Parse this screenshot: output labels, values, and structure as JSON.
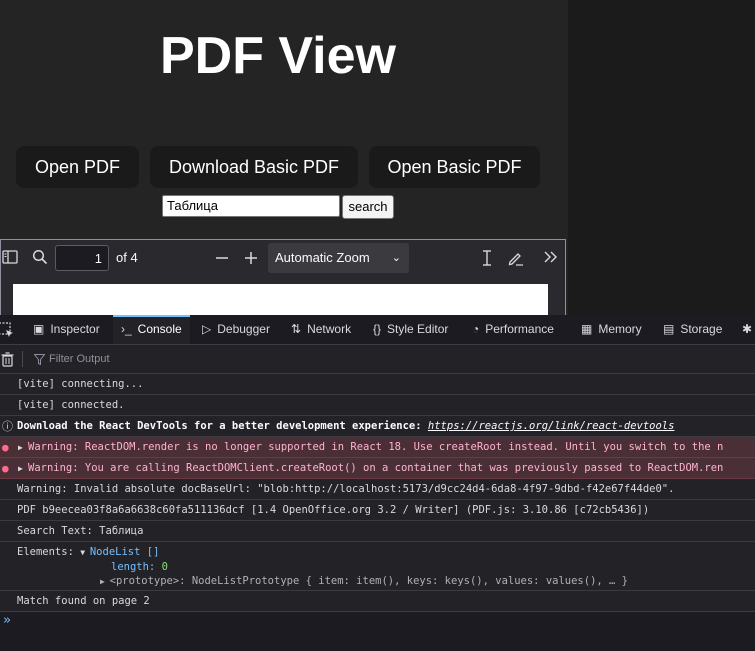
{
  "app": {
    "title": "PDF View",
    "buttons": {
      "open_pdf": "Open PDF",
      "download_basic_pdf": "Download Basic PDF",
      "open_basic_pdf": "Open Basic PDF"
    },
    "search": {
      "value": "Таблица",
      "button_label": "search"
    }
  },
  "pdf_viewer": {
    "page_number": "1",
    "page_count_label": "of 4",
    "zoom": "Automatic Zoom"
  },
  "devtools": {
    "tabs": [
      {
        "label": "Inspector",
        "icon": "inspector-icon"
      },
      {
        "label": "Console",
        "icon": "console-icon",
        "active": true
      },
      {
        "label": "Debugger",
        "icon": "debugger-icon"
      },
      {
        "label": "Network",
        "icon": "network-icon"
      },
      {
        "label": "Style Editor",
        "icon": "style-editor-icon"
      },
      {
        "label": "Performance",
        "icon": "performance-icon"
      },
      {
        "label": "Memory",
        "icon": "memory-icon"
      },
      {
        "label": "Storage",
        "icon": "storage-icon"
      }
    ],
    "filter_placeholder": "Filter Output",
    "console": {
      "m1": "[vite] connecting...",
      "m2": "[vite] connected.",
      "m3_prefix": "Download the React DevTools for a better development experience: ",
      "m3_link": "https://reactjs.org/link/react-devtools",
      "m4": "Warning: ReactDOM.render is no longer supported in React 18. Use createRoot instead. Until you switch to the n",
      "m5": "Warning: You are calling ReactDOMClient.createRoot() on a container that was previously passed to ReactDOM.ren",
      "m6": "Warning: Invalid absolute docBaseUrl: \"blob:http://localhost:5173/d9cc24d4-6da8-4f97-9dbd-f42e67f44de0\".",
      "m7": "PDF b9eecea03f8a6a6638c60fa511136dcf [1.4 OpenOffice.org 3.2 / Writer] (PDF.js: 3.10.86 [c72cb5436])",
      "m8": "Search Text: Таблица",
      "m9_label": "Elements: ",
      "m9_nodelist": "NodeList []",
      "m9_length_key": "length: ",
      "m9_length_val": "0",
      "m9_proto": "<prototype>: NodeListPrototype { item: item(), keys: keys(), values: values(), … }",
      "m10": "Match found on page 2"
    },
    "colors": {
      "accent": "#75bfff",
      "error_bg": "#4b2f36",
      "error_text": "#ffb3d2"
    }
  }
}
